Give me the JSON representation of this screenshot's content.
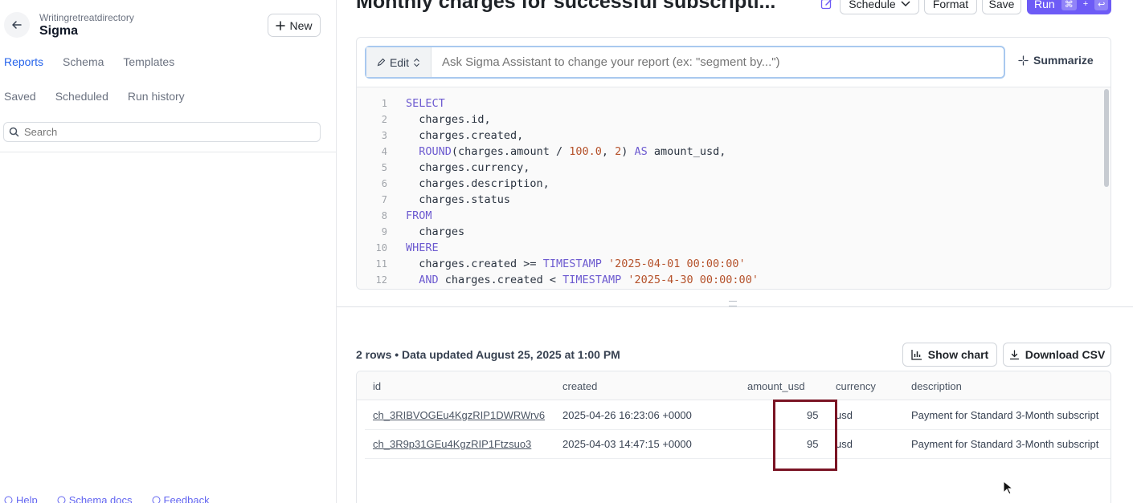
{
  "sidebar": {
    "org_subtitle": "Writingretreatdirectory",
    "org_name": "Sigma",
    "new_label": "New",
    "nav_primary": [
      "Reports",
      "Schema",
      "Templates"
    ],
    "nav_secondary": [
      "Saved",
      "Scheduled",
      "Run history"
    ],
    "search_placeholder": "Search",
    "footer": [
      "Help",
      "Schema docs",
      "Feedback"
    ]
  },
  "header": {
    "title": "Monthly charges for successful subscripti...",
    "schedule_label": "Schedule",
    "format_label": "Format",
    "save_label": "Save",
    "run_label": "Run",
    "run_shortcut_1": "⌘",
    "run_shortcut_plus": "+",
    "run_shortcut_2": "↩"
  },
  "editor": {
    "edit_label": "Edit",
    "assistant_placeholder": "Ask Sigma Assistant to change your report (ex: \"segment by...\")",
    "summarize_label": "Summarize",
    "line_numbers": [
      "1",
      "2",
      "3",
      "4",
      "5",
      "6",
      "7",
      "8",
      "9",
      "10",
      "11",
      "12"
    ]
  },
  "results": {
    "info": "2 rows • Data updated August 25, 2025 at 1:00 PM",
    "show_chart_label": "Show chart",
    "download_csv_label": "Download CSV",
    "columns": [
      "id",
      "created",
      "amount_usd",
      "currency",
      "description"
    ],
    "rows": [
      {
        "id": "ch_3RIBVOGEu4KgzRIP1DWRWrv6",
        "created": "2025-04-26 16:23:06 +0000",
        "amount_usd": "95",
        "currency": "usd",
        "description": "Payment for Standard 3-Month subscript"
      },
      {
        "id": "ch_3R9p31GEu4KgzRIP1Ftzsuo3",
        "created": "2025-04-03 14:47:15 +0000",
        "amount_usd": "95",
        "currency": "usd",
        "description": "Payment for Standard 3-Month subscript"
      }
    ]
  },
  "colors": {
    "accent": "#6d5bf6",
    "link_blue": "#2563eb",
    "highlight_box": "#7a1424"
  }
}
